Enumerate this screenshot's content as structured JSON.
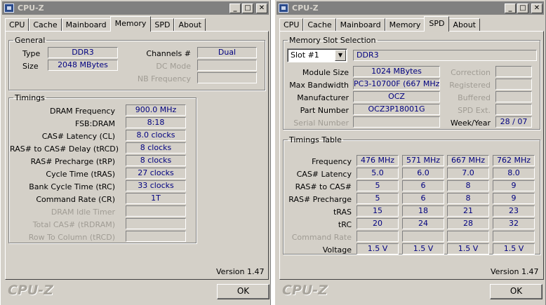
{
  "memory_window": {
    "title": "CPU-Z",
    "tabs": [
      "CPU",
      "Cache",
      "Mainboard",
      "Memory",
      "SPD",
      "About"
    ],
    "active_tab": "Memory",
    "general": {
      "legend": "General",
      "type_label": "Type",
      "type_value": "DDR3",
      "size_label": "Size",
      "size_value": "2048 MBytes",
      "channels_label": "Channels #",
      "channels_value": "Dual",
      "dc_mode_label": "DC Mode",
      "dc_mode_value": "",
      "nb_freq_label": "NB Frequency",
      "nb_freq_value": ""
    },
    "timings": {
      "legend": "Timings",
      "rows": [
        {
          "label": "DRAM Frequency",
          "value": "900.0 MHz",
          "dim": false
        },
        {
          "label": "FSB:DRAM",
          "value": "8:18",
          "dim": false
        },
        {
          "label": "CAS# Latency (CL)",
          "value": "8.0 clocks",
          "dim": false
        },
        {
          "label": "RAS# to CAS# Delay (tRCD)",
          "value": "8 clocks",
          "dim": false
        },
        {
          "label": "RAS# Precharge (tRP)",
          "value": "8 clocks",
          "dim": false
        },
        {
          "label": "Cycle Time (tRAS)",
          "value": "27 clocks",
          "dim": false
        },
        {
          "label": "Bank Cycle Time (tRC)",
          "value": "33 clocks",
          "dim": false
        },
        {
          "label": "Command Rate (CR)",
          "value": "1T",
          "dim": false
        },
        {
          "label": "DRAM Idle Timer",
          "value": "",
          "dim": true
        },
        {
          "label": "Total CAS# (tRDRAM)",
          "value": "",
          "dim": true
        },
        {
          "label": "Row To Column (tRCD)",
          "value": "",
          "dim": true
        }
      ]
    },
    "version": "Version 1.47",
    "brand": "CPU-Z",
    "ok_label": "OK"
  },
  "spd_window": {
    "title": "CPU-Z",
    "tabs": [
      "CPU",
      "Cache",
      "Mainboard",
      "Memory",
      "SPD",
      "About"
    ],
    "active_tab": "SPD",
    "slot": {
      "legend": "Memory Slot Selection",
      "selected": "Slot #1",
      "type_value": "DDR3",
      "module_size_label": "Module Size",
      "module_size_value": "1024 MBytes",
      "max_bw_label": "Max Bandwidth",
      "max_bw_value": "PC3-10700F (667 MHz)",
      "manufacturer_label": "Manufacturer",
      "manufacturer_value": "OCZ",
      "part_label": "Part Number",
      "part_value": "OCZ3P18001G",
      "serial_label": "Serial Number",
      "serial_value": "",
      "correction_label": "Correction",
      "registered_label": "Registered",
      "buffered_label": "Buffered",
      "spd_ext_label": "SPD Ext.",
      "week_year_label": "Week/Year",
      "week_year_value": "28 / 07"
    },
    "timings_table": {
      "legend": "Timings Table",
      "rows": [
        {
          "label": "Frequency",
          "values": [
            "476 MHz",
            "571 MHz",
            "667 MHz",
            "762 MHz"
          ],
          "dim": false
        },
        {
          "label": "CAS# Latency",
          "values": [
            "5.0",
            "6.0",
            "7.0",
            "8.0"
          ],
          "dim": false
        },
        {
          "label": "RAS# to CAS#",
          "values": [
            "5",
            "6",
            "8",
            "9"
          ],
          "dim": false
        },
        {
          "label": "RAS# Precharge",
          "values": [
            "5",
            "6",
            "8",
            "9"
          ],
          "dim": false
        },
        {
          "label": "tRAS",
          "values": [
            "15",
            "18",
            "21",
            "23"
          ],
          "dim": false
        },
        {
          "label": "tRC",
          "values": [
            "20",
            "24",
            "28",
            "32"
          ],
          "dim": false
        },
        {
          "label": "Command Rate",
          "values": [
            "",
            "",
            "",
            ""
          ],
          "dim": true
        },
        {
          "label": "Voltage",
          "values": [
            "1.5 V",
            "1.5 V",
            "1.5 V",
            "1.5 V"
          ],
          "dim": false
        }
      ]
    },
    "version": "Version 1.47",
    "brand": "CPU-Z",
    "ok_label": "OK"
  }
}
